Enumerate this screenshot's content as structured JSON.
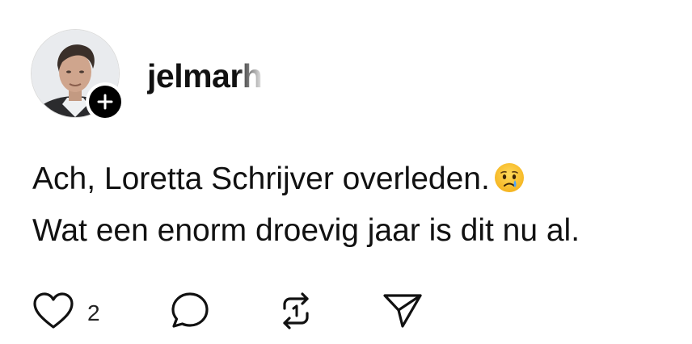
{
  "post": {
    "username": "jelmarh",
    "text_lines": [
      "Ach, Loretta Schrijver overleden.",
      "Wat een enorm droevig jaar is dit nu al."
    ],
    "emoji": "crying-face"
  },
  "actions": {
    "like_count": "2",
    "icons": [
      "heart-icon",
      "comment-icon",
      "repost-icon",
      "share-icon"
    ]
  },
  "colors": {
    "text": "#111111",
    "badge": "#000000",
    "background": "#ffffff"
  }
}
